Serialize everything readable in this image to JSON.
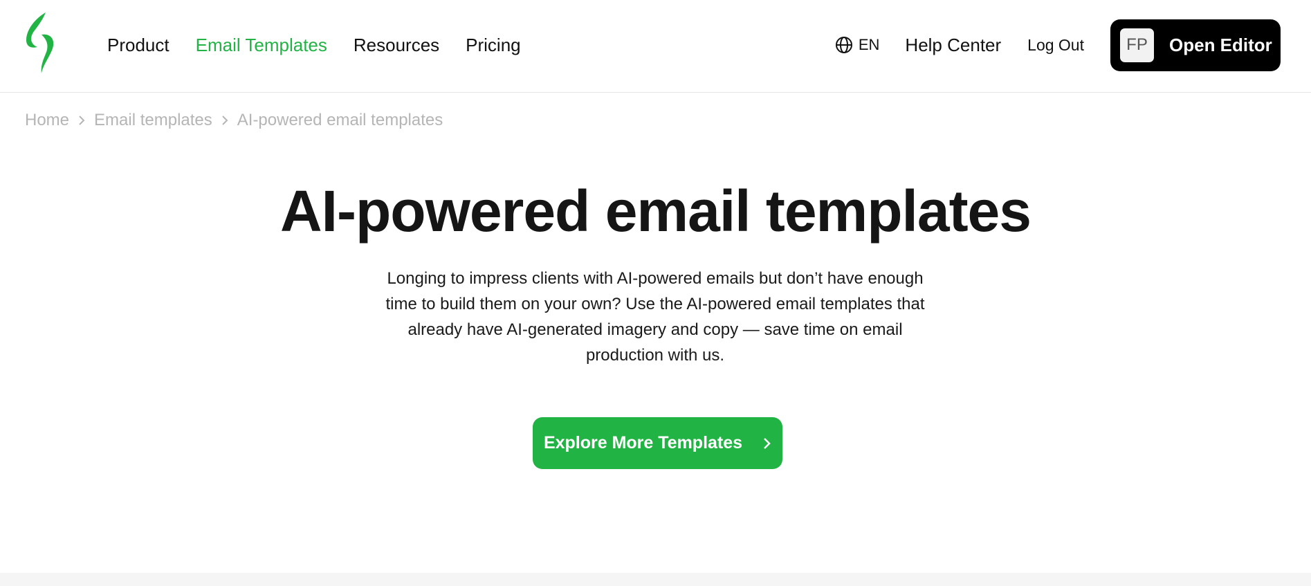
{
  "colors": {
    "accent": "#22b345",
    "editor_button": "#000000",
    "breadcrumb": "#b5b5b5"
  },
  "header": {
    "nav": [
      {
        "label": "Product"
      },
      {
        "label": "Email Templates",
        "active": true
      },
      {
        "label": "Resources"
      },
      {
        "label": "Pricing"
      }
    ],
    "language": {
      "icon": "globe-icon",
      "label": "EN"
    },
    "help_center": "Help Center",
    "log_out": "Log Out",
    "open_editor": {
      "avatar_initials": "FP",
      "label": "Open Editor"
    }
  },
  "breadcrumb": [
    {
      "label": "Home"
    },
    {
      "label": "Email templates"
    },
    {
      "label": "AI-powered email templates"
    }
  ],
  "hero": {
    "title": "AI-powered email templates",
    "description": "Longing to impress clients with AI-powered emails but don’t have enough time to build them on your own? Use the AI-powered email templates that already have AI-generated imagery and copy — save time on email production with us.",
    "cta_label": "Explore More Templates",
    "cta_icon": "chevron-right-icon"
  }
}
